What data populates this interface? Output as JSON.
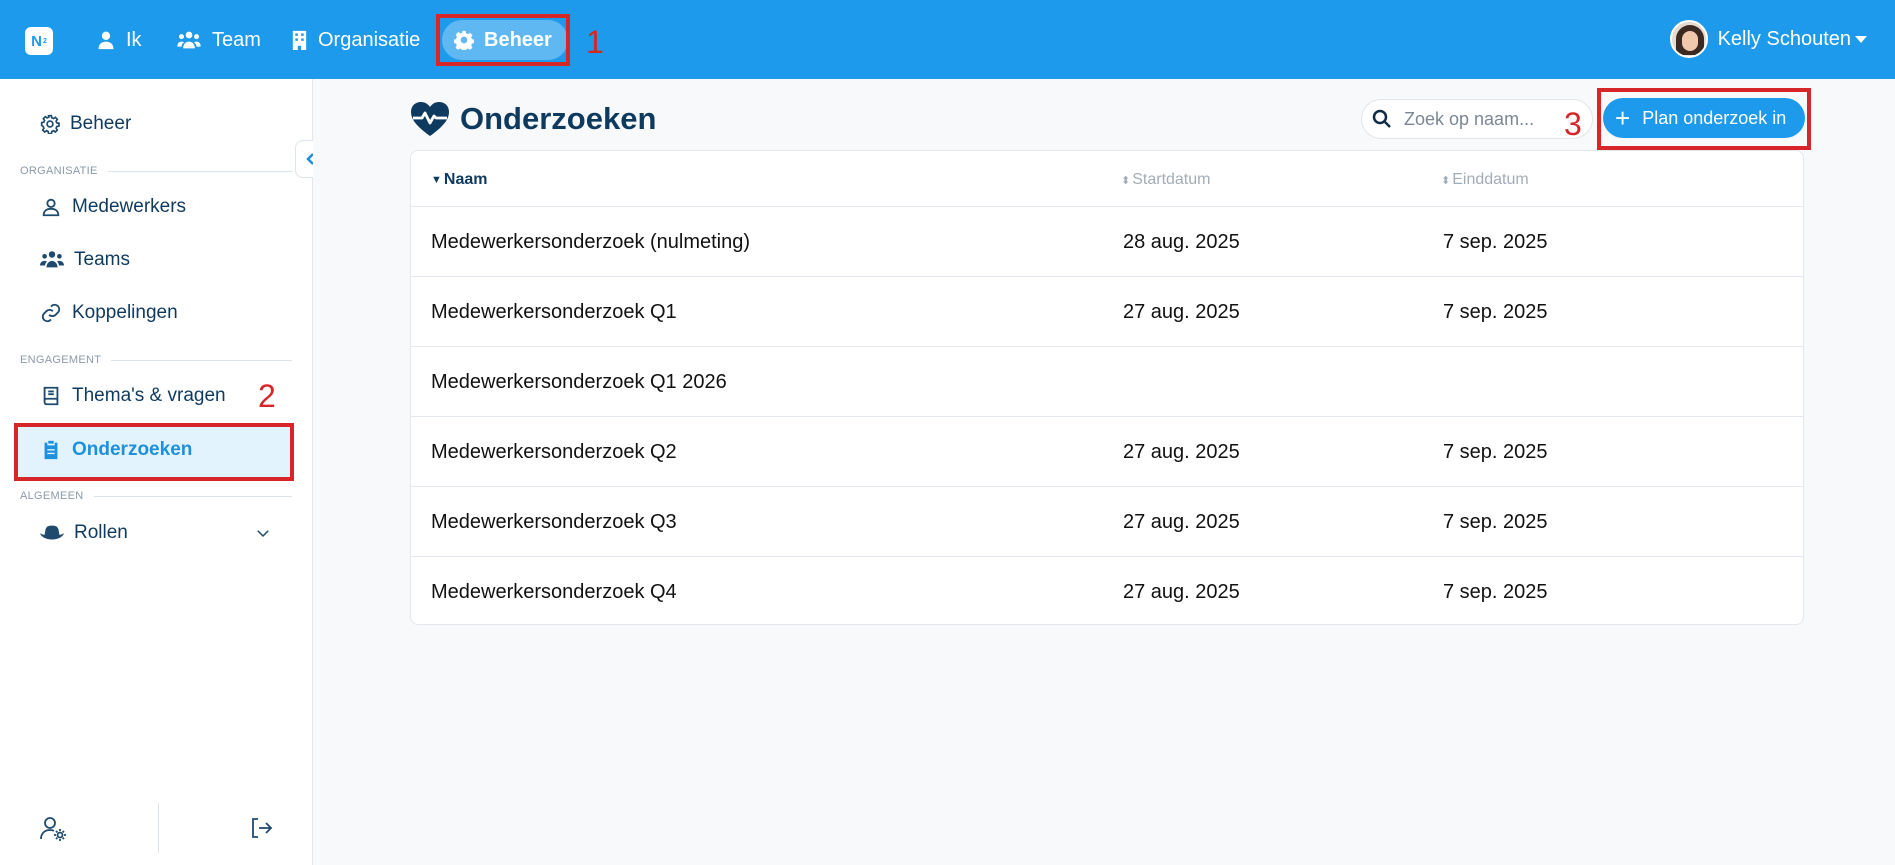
{
  "topbar": {
    "logo": "N",
    "nav": [
      {
        "label": "Ik",
        "icon": "user-icon"
      },
      {
        "label": "Team",
        "icon": "users-icon"
      },
      {
        "label": "Organisatie",
        "icon": "building-icon"
      },
      {
        "label": "Beheer",
        "icon": "gear-icon",
        "active": true
      }
    ],
    "user_name": "Kelly Schouten"
  },
  "sidebar": {
    "beheer": "Beheer",
    "section_organisatie": "ORGANISATIE",
    "medewerkers": "Medewerkers",
    "teams": "Teams",
    "koppelingen": "Koppelingen",
    "section_engagement": "ENGAGEMENT",
    "themas": "Thema's & vragen",
    "onderzoeken": "Onderzoeken",
    "section_algemeen": "ALGEMEEN",
    "rollen": "Rollen"
  },
  "main": {
    "title": "Onderzoeken",
    "search_placeholder": "Zoek op naam...",
    "plan_button": "Plan onderzoek in",
    "columns": {
      "name": "Naam",
      "start": "Startdatum",
      "end": "Einddatum"
    },
    "rows": [
      {
        "name": "Medewerkersonderzoek (nulmeting)",
        "start": "28 aug. 2025",
        "end": "7 sep. 2025"
      },
      {
        "name": "Medewerkersonderzoek Q1",
        "start": "27 aug. 2025",
        "end": "7 sep. 2025"
      },
      {
        "name": "Medewerkersonderzoek Q1 2026",
        "start": "",
        "end": ""
      },
      {
        "name": "Medewerkersonderzoek Q2",
        "start": "27 aug. 2025",
        "end": "7 sep. 2025"
      },
      {
        "name": "Medewerkersonderzoek Q3",
        "start": "27 aug. 2025",
        "end": "7 sep. 2025"
      },
      {
        "name": "Medewerkersonderzoek Q4",
        "start": "27 aug. 2025",
        "end": "7 sep. 2025"
      }
    ]
  },
  "annotations": [
    "1",
    "2",
    "3"
  ],
  "colors": {
    "primary": "#1e9aec",
    "active_bg": "#e3f3fd",
    "annotation": "#d6262a",
    "title": "#0f3a5f"
  }
}
